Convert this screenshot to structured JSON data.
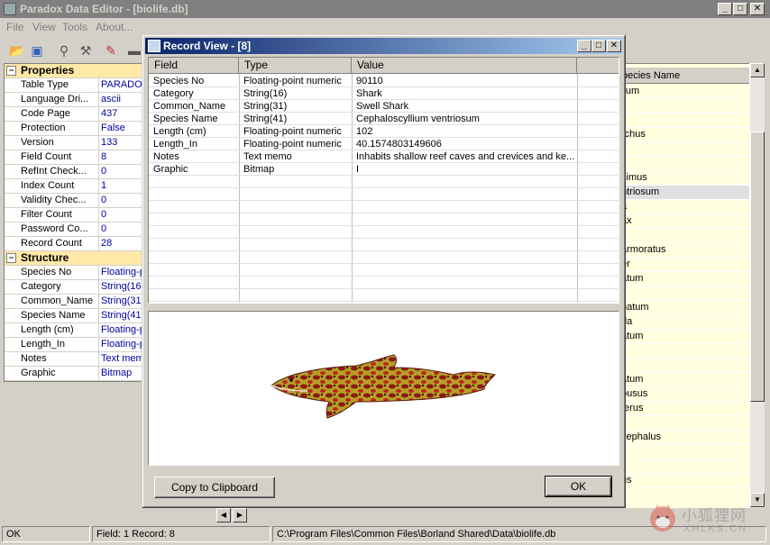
{
  "main_window": {
    "title": "Paradox Data Editor - [biolife.db]",
    "minimize": "_",
    "maximize": "□",
    "close": "✕"
  },
  "menu": [
    "File",
    "View",
    "Tools",
    "About..."
  ],
  "properties": {
    "properties_header": "Properties",
    "properties_rows": [
      {
        "key": "Table Type",
        "value": "PARADOX"
      },
      {
        "key": "Language Dri...",
        "value": "ascii"
      },
      {
        "key": "Code Page",
        "value": "437"
      },
      {
        "key": "Protection",
        "value": "False"
      },
      {
        "key": "Version",
        "value": "133"
      },
      {
        "key": "Field Count",
        "value": "8"
      },
      {
        "key": "RefInt Check...",
        "value": "0"
      },
      {
        "key": "Index Count",
        "value": "1"
      },
      {
        "key": "Validity Chec...",
        "value": "0"
      },
      {
        "key": "Filter Count",
        "value": "0"
      },
      {
        "key": "Password Co...",
        "value": "0"
      },
      {
        "key": "Record Count",
        "value": "28"
      }
    ],
    "structure_header": "Structure",
    "structure_rows": [
      {
        "key": "Species No",
        "value": "Floating-p"
      },
      {
        "key": "Category",
        "value": "String(16)"
      },
      {
        "key": "Common_Name",
        "value": "String(31)"
      },
      {
        "key": "Species Name",
        "value": "String(41)"
      },
      {
        "key": "Length (cm)",
        "value": "Floating-p"
      },
      {
        "key": "Length_In",
        "value": "Floating-p"
      },
      {
        "key": "Notes",
        "value": "Text memo"
      },
      {
        "key": "Graphic",
        "value": "Bitmap"
      }
    ]
  },
  "right_table": {
    "header": "pecies Name",
    "rows": [
      "llum",
      "",
      "",
      "rchus",
      "",
      "",
      "simus",
      "ntriosum",
      "a",
      "ax",
      "s",
      "armoratus",
      "er",
      "atum",
      "",
      "natum",
      "da",
      "atum",
      "",
      "s",
      "atum",
      "ousus",
      "terus",
      "",
      "cephalus",
      "",
      "",
      "us"
    ]
  },
  "statusbar": {
    "status": "OK",
    "position": "Field: 1  Record: 8",
    "path": "C:\\Program Files\\Common Files\\Borland Shared\\Data\\biolife.db"
  },
  "dialog": {
    "title": "Record View - [8]",
    "minimize": "_",
    "maximize": "□",
    "close": "✕",
    "columns": [
      "Field",
      "Type",
      "Value"
    ],
    "rows": [
      {
        "field": "Species No",
        "type": "Floating-point numeric",
        "value": "90110"
      },
      {
        "field": "Category",
        "type": "String(16)",
        "value": "Shark"
      },
      {
        "field": "Common_Name",
        "type": "String(31)",
        "value": "Swell Shark"
      },
      {
        "field": "Species Name",
        "type": "String(41)",
        "value": "Cephaloscyllium ventriosum"
      },
      {
        "field": "Length (cm)",
        "type": "Floating-point numeric",
        "value": "102"
      },
      {
        "field": "Length_In",
        "type": "Floating-point numeric",
        "value": "40.1574803149606"
      },
      {
        "field": "Notes",
        "type": "Text memo",
        "value": "Inhabits shallow reef caves and crevices and ke..."
      },
      {
        "field": "Graphic",
        "type": "Bitmap",
        "value": "I"
      }
    ],
    "copy_button": "Copy to Clipboard",
    "ok_button": "OK"
  },
  "watermark": {
    "text_cn": "小狐狸网",
    "text_en": "XHLKS.CN"
  }
}
